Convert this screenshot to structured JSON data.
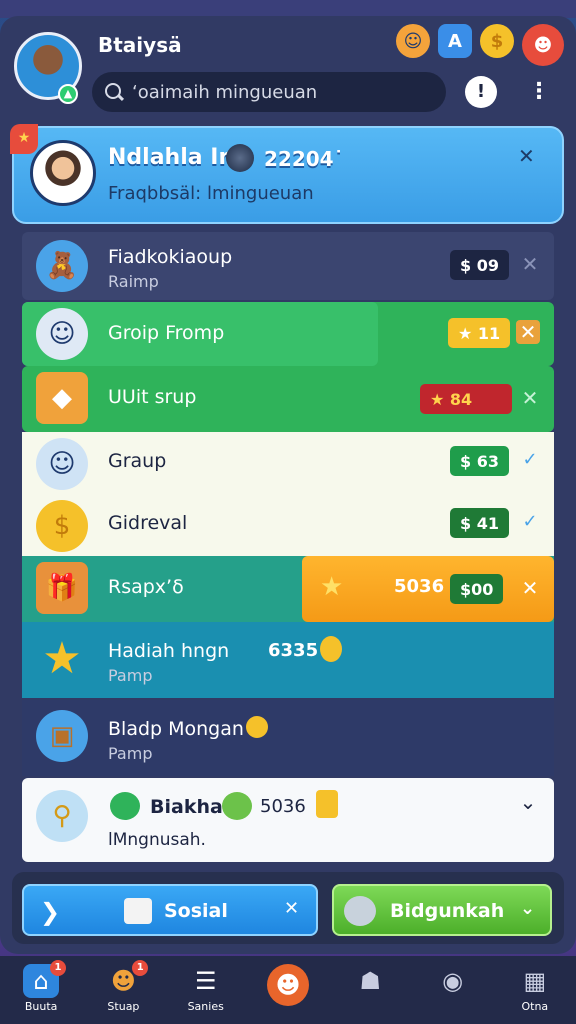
{
  "header": {
    "user_name": "Btaiysä",
    "search_placeholder": "‘oaimaih mingueuan",
    "info_label": "!",
    "more_label": "⋮"
  },
  "top_icons": [
    {
      "name": "face-avatar-icon",
      "glyph": "☺"
    },
    {
      "name": "a-logo-icon",
      "glyph": "A"
    },
    {
      "name": "coin-icon",
      "glyph": "$"
    },
    {
      "name": "mascot-icon",
      "glyph": "☻"
    }
  ],
  "highlight": {
    "title": "Ndlahla In",
    "number": "22204˙",
    "subtitle": "Fraqbbsäl: lmingueuan",
    "close_label": "✕"
  },
  "rows": [
    {
      "title": "Fiadkokiaoup",
      "sub": "Raimp",
      "pill": "$ 09",
      "action": "✕",
      "icon": "teddy-bear-icon",
      "glyph": "🧸"
    },
    {
      "title": "Groip Fromp",
      "sub": "",
      "pill": "★ 11",
      "action": "✕",
      "icon": "boy-avatar-icon",
      "glyph": "☺"
    },
    {
      "title": "UUit srup",
      "sub": "",
      "pill": "★ 84",
      "action": "✕",
      "icon": "treasure-chest-icon",
      "glyph": "◆"
    },
    {
      "title": "Graup",
      "sub": "",
      "pill": "$ 63",
      "action": "✓",
      "icon": "child-avatar-icon",
      "glyph": "☺"
    },
    {
      "title": "Gidreval",
      "sub": "",
      "pill": "$ 41",
      "action": "✓",
      "icon": "gold-coin-icon",
      "glyph": "$"
    },
    {
      "title": "Rsapx’δ",
      "sub": "",
      "pill_score": "5036",
      "pill": "$00",
      "action": "✕",
      "icon": "gift-box-icon",
      "glyph": "🎁"
    },
    {
      "title": "Hadiah hngn",
      "sub": "Pamp",
      "extra": "6335",
      "icon": "star-icon",
      "glyph": "★"
    },
    {
      "title": "Bladp Mongan",
      "sub": "Pamp",
      "icon": "chest-icon",
      "glyph": "▣"
    },
    {
      "title": "Biakha",
      "sub": "lMngnusah.",
      "extra": "5036",
      "action": "⌄",
      "icon": "magnifier-coin-icon",
      "glyph": "⚲"
    }
  ],
  "footer": {
    "social_label": "Sosial",
    "social_close": "✕",
    "green_label": "Bidgunkah",
    "green_chev": "⌄"
  },
  "nav": [
    {
      "label": "Buuta",
      "badge": "1",
      "icon": "home-icon",
      "glyph": "⌂"
    },
    {
      "label": "Stuap",
      "badge": "1",
      "icon": "bear-icon",
      "glyph": "☻"
    },
    {
      "label": "Sanies",
      "icon": "list-icon",
      "glyph": "☰"
    },
    {
      "label": "",
      "icon": "fox-mascot-icon",
      "glyph": "☻"
    },
    {
      "label": "",
      "icon": "people-icon",
      "glyph": "☗"
    },
    {
      "label": "",
      "icon": "location-pin-icon",
      "glyph": "◉"
    },
    {
      "label": "Otna",
      "icon": "gallery-icon",
      "glyph": "▦"
    }
  ]
}
